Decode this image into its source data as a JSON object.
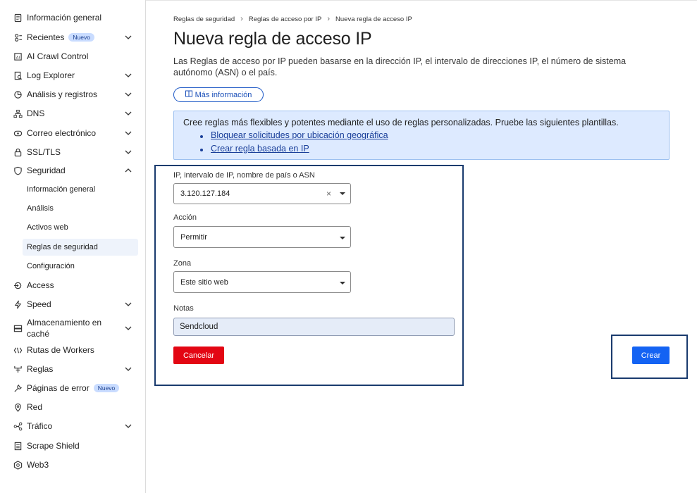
{
  "sidebar": {
    "items": [
      {
        "label": "Información general",
        "icon": "document-icon",
        "chevron": false,
        "badge": ""
      },
      {
        "label": "Recientes",
        "icon": "recent-icon",
        "chevron": true,
        "badge": "Nuevo"
      },
      {
        "label": "AI Crawl Control",
        "icon": "ai-crawl-icon",
        "chevron": false,
        "badge": ""
      },
      {
        "label": "Log Explorer",
        "icon": "log-explorer-icon",
        "chevron": true,
        "badge": ""
      },
      {
        "label": "Análisis y registros",
        "icon": "analytics-icon",
        "chevron": true,
        "badge": ""
      },
      {
        "label": "DNS",
        "icon": "dns-icon",
        "chevron": true,
        "badge": ""
      },
      {
        "label": "Correo electrónico",
        "icon": "email-icon",
        "chevron": true,
        "badge": ""
      },
      {
        "label": "SSL/TLS",
        "icon": "lock-icon",
        "chevron": true,
        "badge": ""
      },
      {
        "label": "Seguridad",
        "icon": "shield-icon",
        "chevron": true,
        "badge": ""
      }
    ],
    "security_sub": [
      "Información general",
      "Análisis",
      "Activos web",
      "Reglas de seguridad",
      "Configuración"
    ],
    "items_after": [
      {
        "label": "Access",
        "icon": "access-icon",
        "chevron": false,
        "badge": ""
      },
      {
        "label": "Speed",
        "icon": "lightning-icon",
        "chevron": true,
        "badge": ""
      },
      {
        "label": "Almacenamiento en caché",
        "line1": "Almacenamiento en",
        "line2": "caché",
        "icon": "cache-icon",
        "chevron": true,
        "badge": ""
      },
      {
        "label": "Rutas de Workers",
        "icon": "workers-icon",
        "chevron": false,
        "badge": ""
      },
      {
        "label": "Reglas",
        "icon": "rules-icon",
        "chevron": true,
        "badge": ""
      },
      {
        "label": "Páginas de error",
        "icon": "wrench-icon",
        "chevron": false,
        "badge": "Nuevo"
      },
      {
        "label": "Red",
        "icon": "location-icon",
        "chevron": false,
        "badge": ""
      },
      {
        "label": "Tráfico",
        "icon": "traffic-icon",
        "chevron": true,
        "badge": ""
      },
      {
        "label": "Scrape Shield",
        "icon": "scrape-shield-icon",
        "chevron": false,
        "badge": ""
      },
      {
        "label": "Web3",
        "icon": "web3-icon",
        "chevron": false,
        "badge": ""
      }
    ]
  },
  "breadcrumbs": [
    "Reglas de seguridad",
    "Reglas de acceso por IP",
    "Nueva regla de acceso IP"
  ],
  "page": {
    "title": "Nueva regla de acceso IP",
    "description": "Las Reglas de acceso por IP pueden basarse en la dirección IP, el intervalo de direcciones IP, el número de sistema autónomo (ASN) o el país.",
    "more_info": "Más información"
  },
  "info_box": {
    "text": "Cree reglas más flexibles y potentes mediante el uso de reglas personalizadas. Pruebe las siguientes plantillas.",
    "links": [
      "Bloquear solicitudes por ubicación geográfica",
      "Crear regla basada en IP"
    ]
  },
  "form": {
    "ip_label": "IP, intervalo de IP, nombre de país o ASN",
    "ip_value": "3.120.127.184",
    "action_label": "Acción",
    "action_value": "Permitir",
    "zone_label": "Zona",
    "zone_value": "Este sitio web",
    "notes_label": "Notas",
    "notes_value": "Sendcloud",
    "cancel": "Cancelar",
    "create": "Crear"
  },
  "colors": {
    "accent": "#1463f3",
    "danger": "#e30613",
    "info_bg": "#ddeaff",
    "highlight_border": "#1a3b6e"
  }
}
